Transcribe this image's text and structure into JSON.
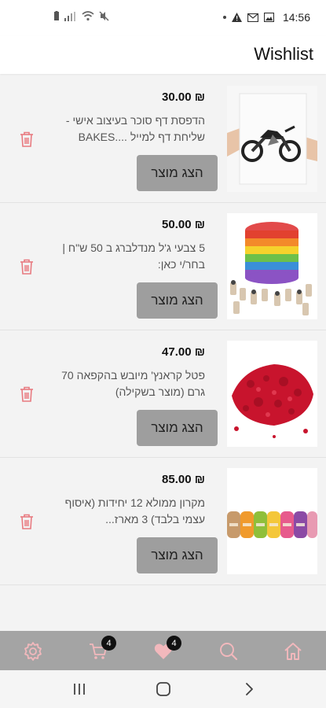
{
  "status": {
    "time": "14:56"
  },
  "header": {
    "title": "Wishlist"
  },
  "button_label": "הצג מוצר",
  "items": [
    {
      "price": "30.00 ₪",
      "description": "הדפסת דף סוכר בעיצוב אישי - שליחת דף למייל ....BAKES",
      "image": "motorcycle-print"
    },
    {
      "price": "50.00 ₪",
      "description": "5 צבעי ג'ל מנדלברג ב 50 ש\"ח | בחר/י כאן:",
      "image": "rainbow-cake"
    },
    {
      "price": "47.00 ₪",
      "description": "פטל קראנץ' מיובש בהקפאה 70 גרם (מוצר בשקילה)",
      "image": "raspberry-crunch"
    },
    {
      "price": "85.00 ₪",
      "description": "מקרון ממולא 12 יחידות (איסוף עצמי בלבד) 3 מארז...",
      "image": "macarons"
    }
  ],
  "bottom_nav": {
    "cart_count": "4",
    "wishlist_count": "4",
    "icon_color": "#f2b8bc"
  }
}
